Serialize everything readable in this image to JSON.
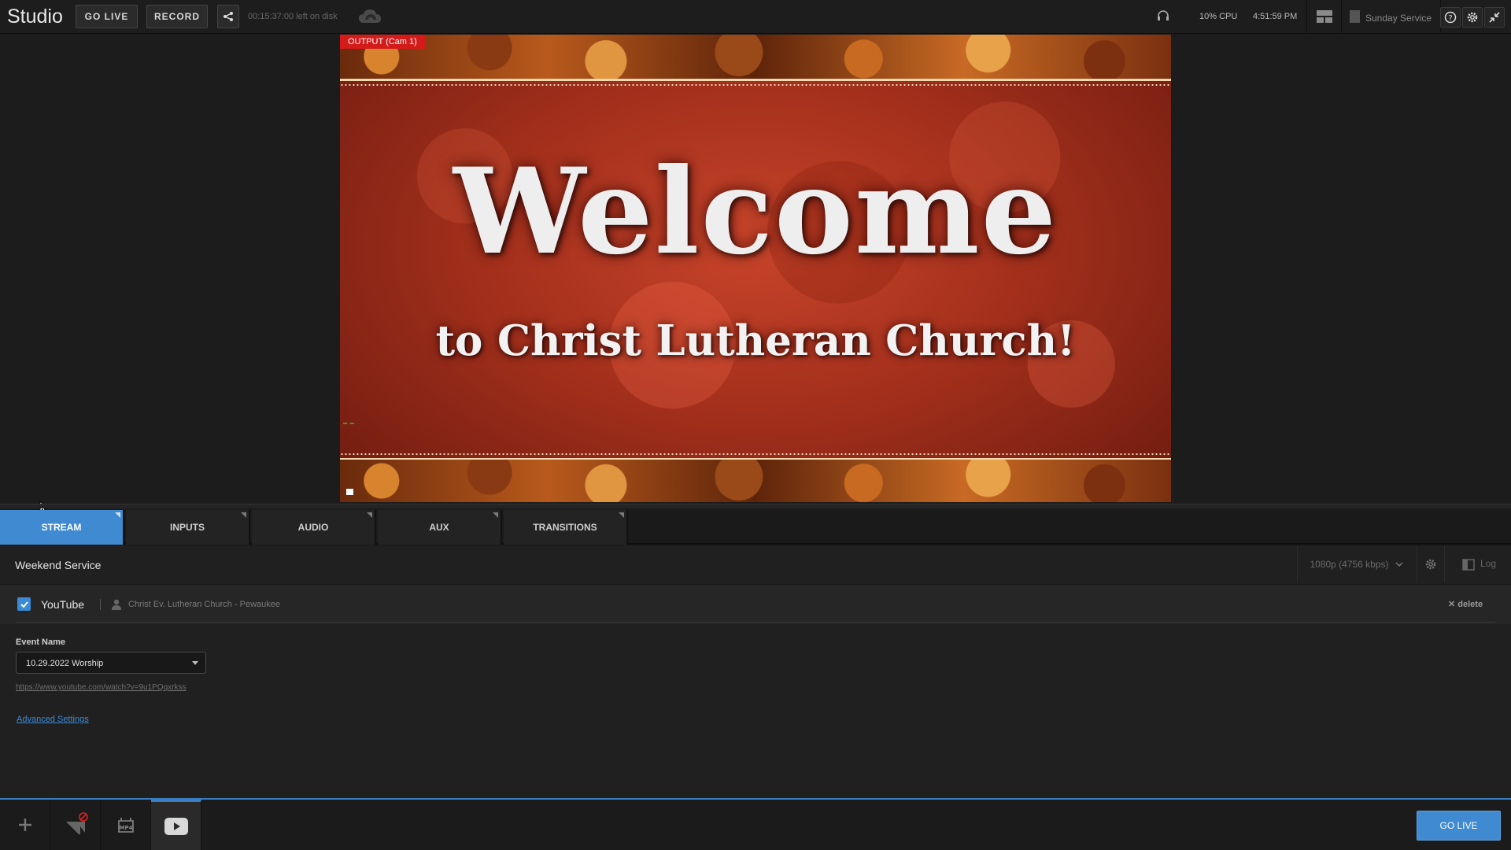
{
  "app": {
    "name": "Studio",
    "disk_status": "00:15:37:00 left on disk",
    "cpu": "10% CPU",
    "time": "4:51:59 PM",
    "production_name": "Sunday Service"
  },
  "toolbar": {
    "golive_label": "GO LIVE",
    "record_label": "RECORD"
  },
  "preview": {
    "output_label": "OUTPUT (Cam 1)",
    "headline": "Welcome",
    "subline": "to Christ Lutheran Church!"
  },
  "tabs": [
    {
      "label": "STREAM",
      "active": true
    },
    {
      "label": "INPUTS",
      "active": false
    },
    {
      "label": "AUDIO",
      "active": false
    },
    {
      "label": "AUX",
      "active": false
    },
    {
      "label": "TRANSITIONS",
      "active": false
    }
  ],
  "stream": {
    "title": "Weekend Service",
    "quality": "1080p (4756 kbps)",
    "log_label": "Log",
    "destination": {
      "enabled": true,
      "platform": "YouTube",
      "account": "Christ Ev. Lutheran Church - Pewaukee",
      "delete_label": "delete"
    },
    "event_name_label": "Event Name",
    "event_name_value": "10.29.2022 Worship",
    "url": "https://www.youtube.com/watch?v=9u1PQqxrkss",
    "advanced_label": "Advanced Settings"
  },
  "bottombar": {
    "golive_label": "GO LIVE",
    "icons": [
      "add-icon",
      "social-blocked-icon",
      "mp4-icon",
      "youtube-icon"
    ]
  },
  "colors": {
    "accent": "#3f8ad0",
    "output_badge": "#d51a1a"
  }
}
